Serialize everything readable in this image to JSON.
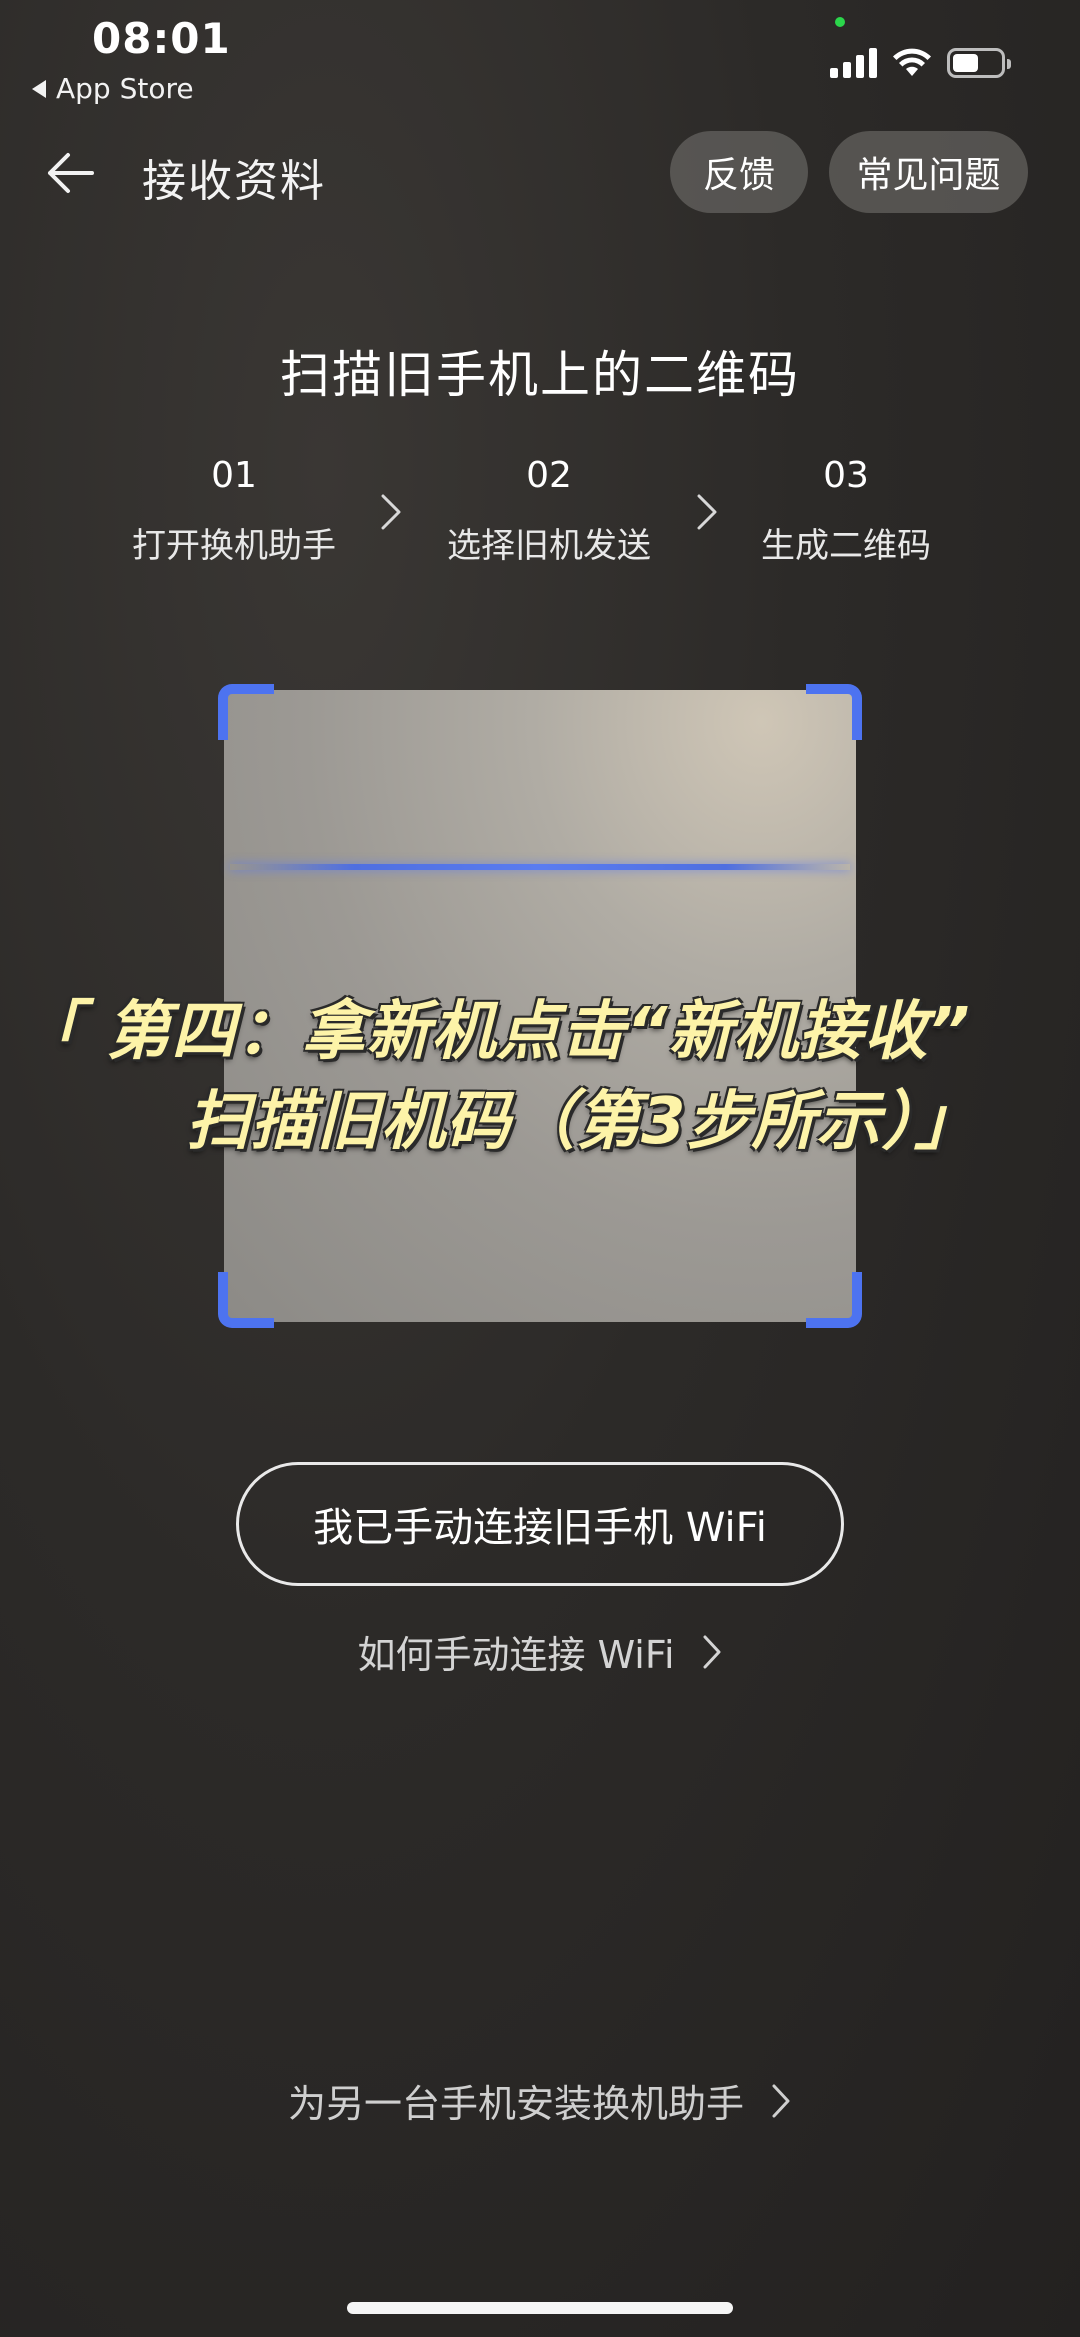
{
  "status_bar": {
    "time": "08:01",
    "back_app": "App Store"
  },
  "header": {
    "title": "接收资料",
    "feedback_label": "反馈",
    "faq_label": "常见问题"
  },
  "scan": {
    "title": "扫描旧手机上的二维码",
    "steps": [
      {
        "num": "01",
        "label": "打开换机助手"
      },
      {
        "num": "02",
        "label": "选择旧机发送"
      },
      {
        "num": "03",
        "label": "生成二维码"
      }
    ]
  },
  "overlay_caption": {
    "line1": "「 第四：拿新机点击“新机接收”",
    "line2": "扫描旧机码（第3步所示）」"
  },
  "actions": {
    "wifi_connected_button": "我已手动连接旧手机 WiFi",
    "how_to_connect_link": "如何手动连接 WiFi",
    "install_link": "为另一台手机安装换机助手"
  },
  "colors": {
    "accent_blue": "#4d73f0",
    "caption_yellow": "#fdf3a8",
    "background": "#2c2a28"
  }
}
